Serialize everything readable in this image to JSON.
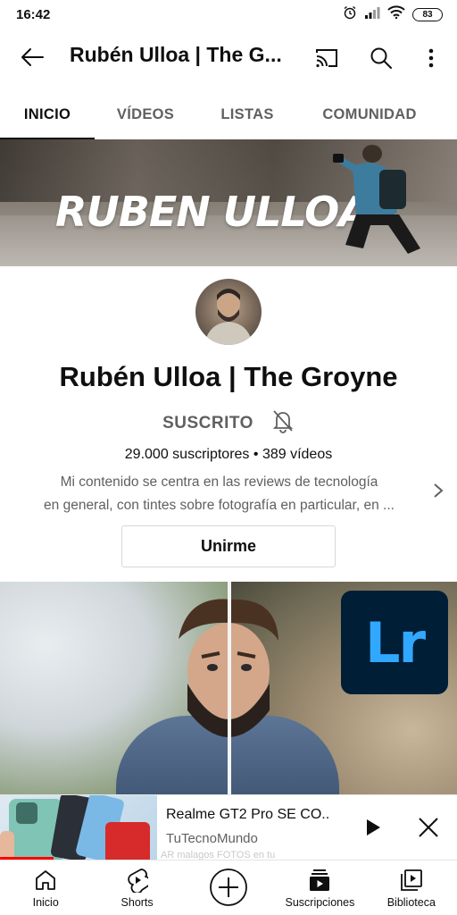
{
  "status_bar": {
    "time": "16:42",
    "battery": "83"
  },
  "app_bar": {
    "title": "Rubén Ulloa | The G...",
    "icons": [
      "back-arrow-icon",
      "cast-icon",
      "search-icon",
      "more-vert-icon"
    ]
  },
  "tabs": [
    {
      "label": "INICIO",
      "active": true
    },
    {
      "label": "VÍDEOS",
      "active": false
    },
    {
      "label": "LISTAS",
      "active": false
    },
    {
      "label": "COMUNIDAD",
      "active": false
    }
  ],
  "banner": {
    "text": "RUBEN ULLOA"
  },
  "channel": {
    "name": "Rubén Ulloa | The Groyne",
    "subscribed_label": "SUSCRITO",
    "subscribers": "29.000 suscriptores",
    "separator": "•",
    "videos": "389 vídeos",
    "description_line1": "Mi contenido se centra en las reviews de tecnología",
    "description_line2": "en general, con tintes sobre fotografía en particular, en ...",
    "join_label": "Unirme"
  },
  "featured": {
    "badge_text": "Lr"
  },
  "mini_player": {
    "title": "Realme GT2 Pro SE CO..",
    "channel": "TuTecnoMundo",
    "background_text": "AR malagos FOTOS en tu",
    "progress": 0.34
  },
  "bottom_nav": [
    {
      "label": "Inicio",
      "icon": "home-icon"
    },
    {
      "label": "Shorts",
      "icon": "shorts-icon"
    },
    {
      "label": "",
      "icon": "create-plus-icon"
    },
    {
      "label": "Suscripciones",
      "icon": "subscriptions-icon"
    },
    {
      "label": "Biblioteca",
      "icon": "library-icon"
    }
  ],
  "colors": {
    "accent_red": "#ff0000",
    "text_primary": "#0f0f0f",
    "text_secondary": "#606060",
    "lightroom_bg": "#001e36",
    "lightroom_fg": "#31a8ff"
  }
}
